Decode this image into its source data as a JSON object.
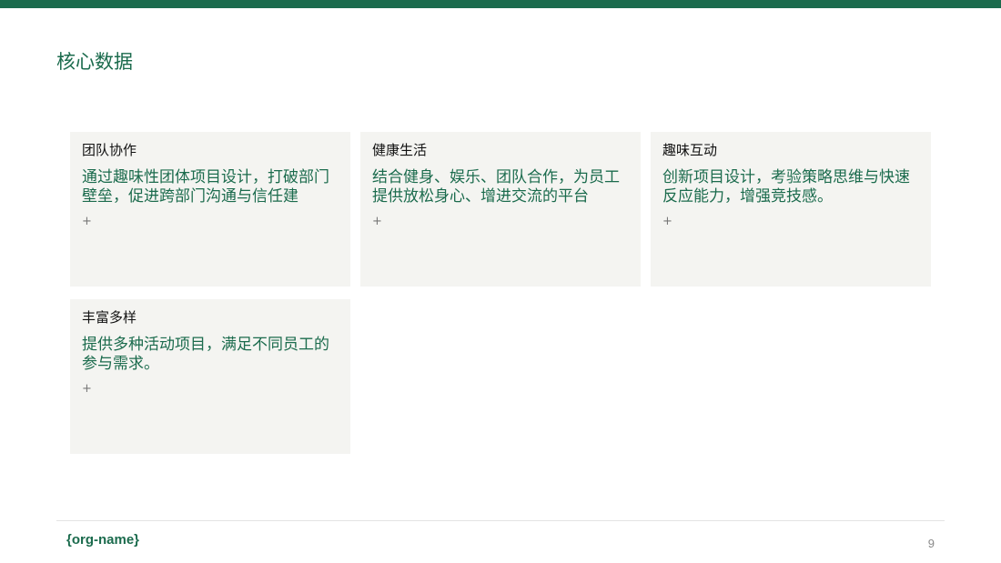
{
  "slide": {
    "title": "核心数据",
    "accent_color": "#1b6b4d",
    "card_background": "#f4f4f1",
    "cards": [
      {
        "title": "团队协作",
        "description": "通过趣味性团体项目设计，打破部门壁垒，促进跨部门沟通与信任建",
        "plus": "+"
      },
      {
        "title": "健康生活",
        "description": "结合健身、娱乐、团队合作，为员工提供放松身心、增进交流的平台",
        "plus": "+"
      },
      {
        "title": "趣味互动",
        "description": "创新项目设计，考验策略思维与快速反应能力，增强竞技感。",
        "plus": "+"
      },
      {
        "title": "丰富多样",
        "description": "提供多种活动项目，满足不同员工的参与需求。",
        "plus": "+"
      }
    ]
  },
  "footer": {
    "org_name": "{org-name}",
    "page_number": "9"
  }
}
